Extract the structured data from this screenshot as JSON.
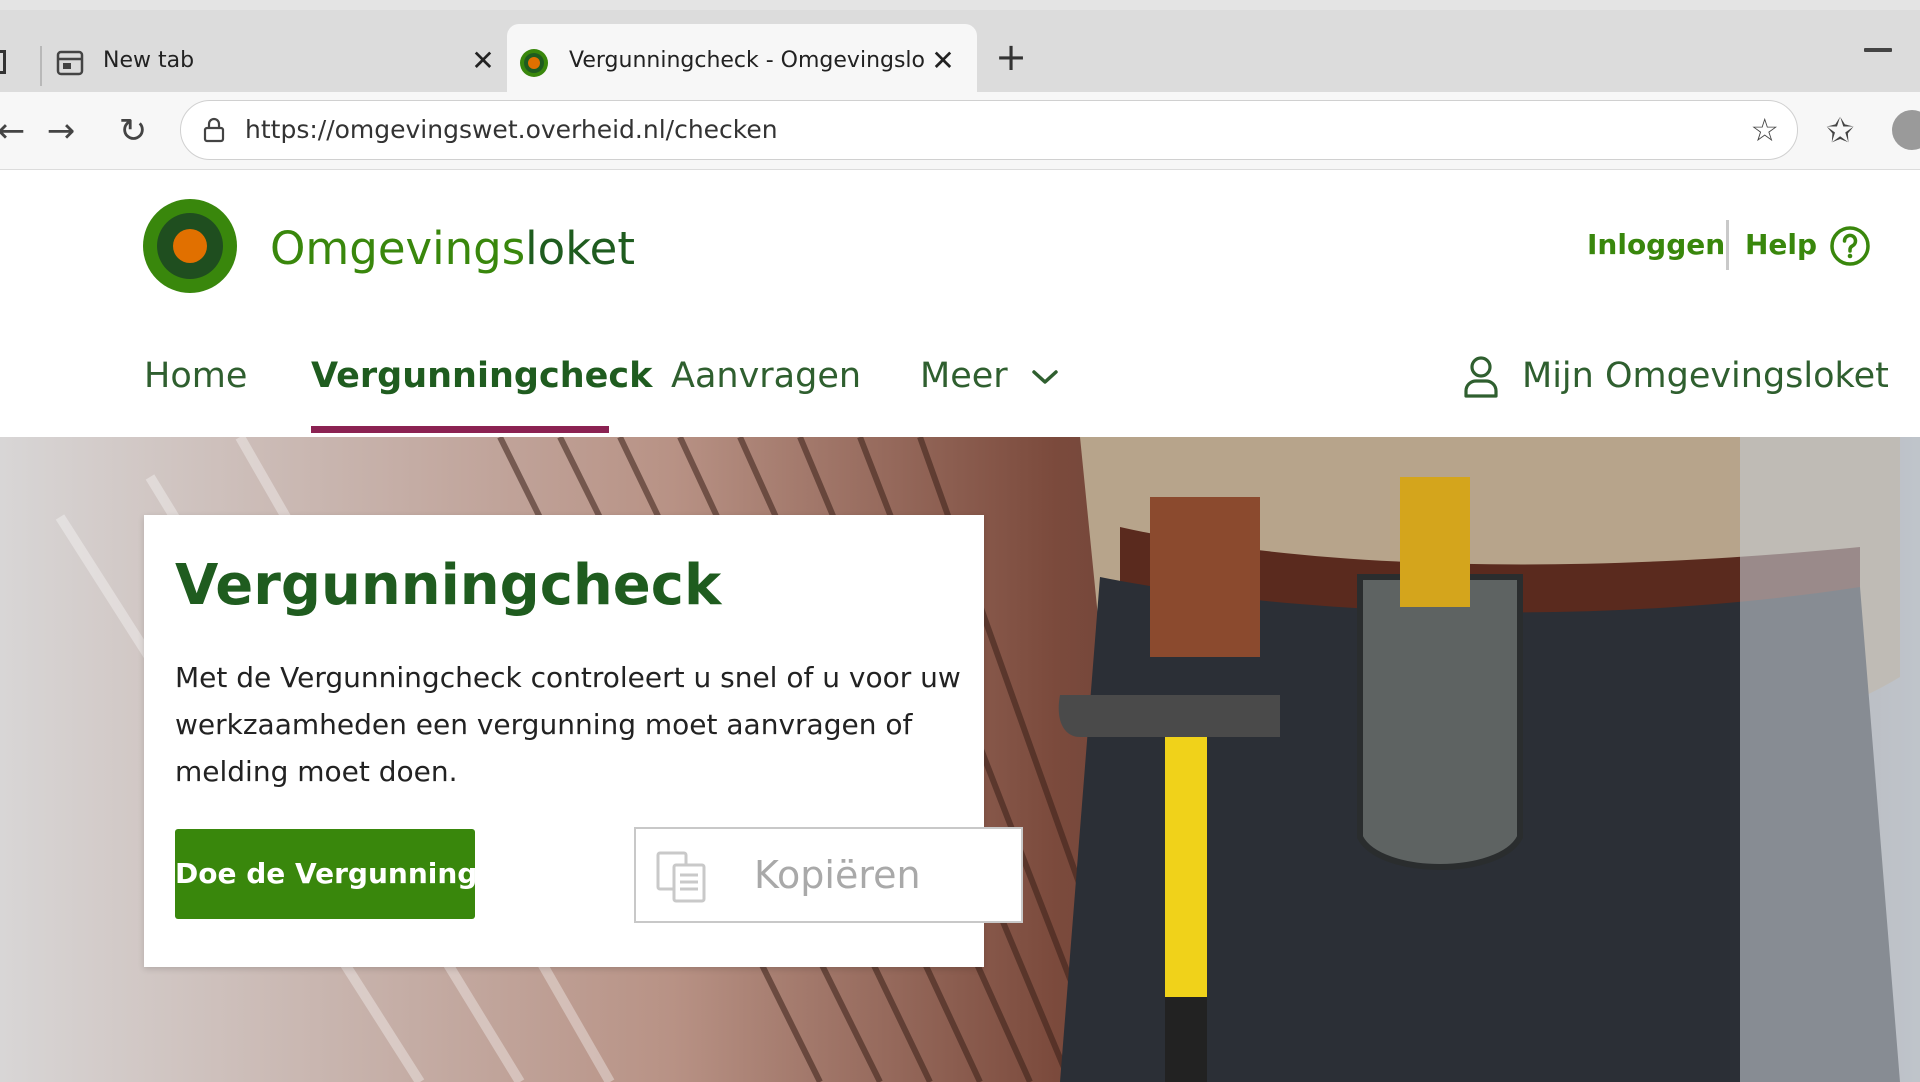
{
  "browser": {
    "tabs": [
      {
        "title": "New tab",
        "close": "✕"
      },
      {
        "title": "Vergunningcheck - Omgevingsloket",
        "close": "✕"
      }
    ],
    "new_tab_symbol": "+",
    "url": "https://omgevingswet.overheid.nl/checken",
    "icons": {
      "back": "back-arrow-icon",
      "forward": "forward-arrow-icon",
      "reload": "reload-icon",
      "lock": "lock-icon",
      "bookmark": "star-icon",
      "favorites": "favorites-icon",
      "profile": "profile-icon"
    }
  },
  "header": {
    "brand_part1": "Omgevings",
    "brand_part2": "loket",
    "login": "Inloggen",
    "help": "Help"
  },
  "nav": {
    "items": [
      "Home",
      "Vergunningcheck",
      "Aanvragen",
      "Meer"
    ],
    "active": "Vergunningcheck",
    "account": "Mijn Omgevingsloket"
  },
  "hero": {
    "title": "Vergunningcheck",
    "text": "Met de Vergunningcheck controleert u snel of u voor uw werkzaamheden een vergunning moet aanvragen of melding moet doen.",
    "cta": "Doe de Vergunningcheck",
    "copy": "Kopiëren"
  },
  "colors": {
    "brand_green": "#39870c",
    "dark_green": "#1f5c1f",
    "logo_orange": "#e17000",
    "nav_underline": "#8b2252"
  }
}
